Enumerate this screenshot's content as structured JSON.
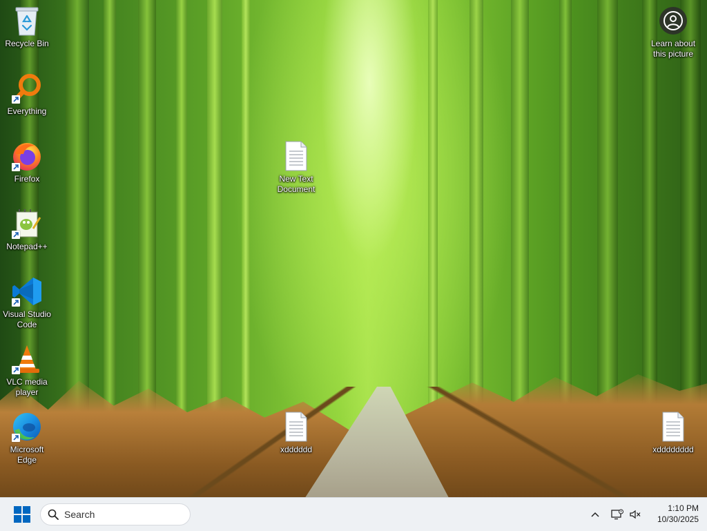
{
  "desktop": {
    "icons": [
      {
        "label": "Recycle Bin"
      },
      {
        "label": "Everything"
      },
      {
        "label": "Firefox"
      },
      {
        "label": "Notepad++"
      },
      {
        "label": "Visual Studio Code"
      },
      {
        "label": "VLC media player"
      },
      {
        "label": "Microsoft Edge"
      },
      {
        "label": "New Text Document"
      },
      {
        "label": "xdddddd"
      },
      {
        "label": "xdddddddd"
      },
      {
        "label": "Learn about this picture"
      }
    ]
  },
  "taskbar": {
    "search_placeholder": "Search",
    "clock_time": "1:10 PM",
    "clock_date": "10/30/2025"
  },
  "colors": {
    "taskbar_bg": "#eef1f4",
    "start_blue": "#0067c0",
    "vscode_blue": "#0a7ad6",
    "vlc_orange": "#f07b0d"
  }
}
